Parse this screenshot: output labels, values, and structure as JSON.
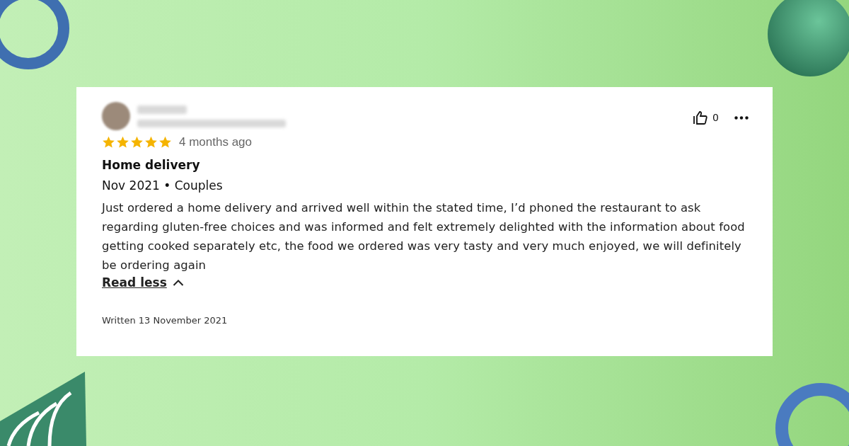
{
  "review": {
    "stars": 5,
    "age": "4 months ago",
    "title": "Home delivery",
    "meta": "Nov 2021 • Couples",
    "body": "Just ordered a home delivery and arrived well within the stated time, I’d phoned the restaurant to ask regarding gluten-free choices and was informed and felt extremely delighted with the information about food getting cooked separately etc, the food we ordered was very tasty and very much enjoyed, we will definitely be ordering again",
    "toggle": "Read less",
    "expanded": true,
    "likes": "0",
    "written": "Written 13 November 2021"
  }
}
